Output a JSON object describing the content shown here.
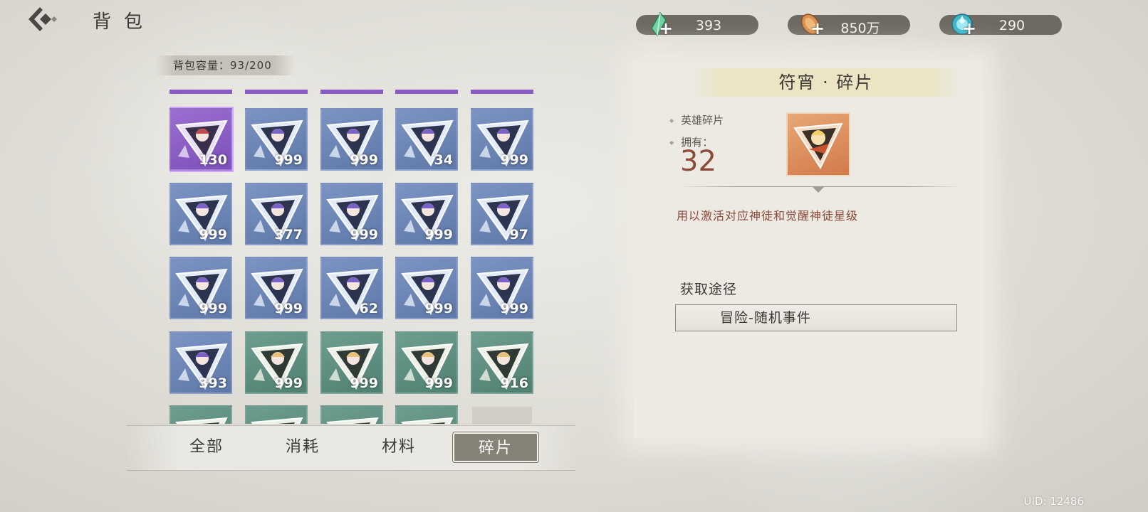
{
  "header": {
    "title": "背包"
  },
  "currencies": [
    {
      "icon": "green-crystal-icon",
      "value": "393"
    },
    {
      "icon": "coin-icon",
      "value": "850万"
    },
    {
      "icon": "blue-gem-icon",
      "value": "290"
    }
  ],
  "capacity": {
    "text": "背包容量：93/200"
  },
  "grid": {
    "items": [
      {
        "rarity": "purple",
        "count": "130",
        "selected": true
      },
      {
        "rarity": "blue",
        "count": "999"
      },
      {
        "rarity": "blue",
        "count": "999"
      },
      {
        "rarity": "blue",
        "count": "34"
      },
      {
        "rarity": "blue",
        "count": "999"
      },
      {
        "rarity": "blue",
        "count": "999"
      },
      {
        "rarity": "blue",
        "count": "377"
      },
      {
        "rarity": "blue",
        "count": "999"
      },
      {
        "rarity": "blue",
        "count": "999"
      },
      {
        "rarity": "blue",
        "count": "97"
      },
      {
        "rarity": "blue",
        "count": "999"
      },
      {
        "rarity": "blue",
        "count": "999"
      },
      {
        "rarity": "blue",
        "count": "62"
      },
      {
        "rarity": "blue",
        "count": "999"
      },
      {
        "rarity": "blue",
        "count": "999"
      },
      {
        "rarity": "blue",
        "count": "393"
      },
      {
        "rarity": "green",
        "count": "999"
      },
      {
        "rarity": "green",
        "count": "999"
      },
      {
        "rarity": "green",
        "count": "999"
      },
      {
        "rarity": "green",
        "count": "916"
      },
      {
        "rarity": "green",
        "count": ""
      },
      {
        "rarity": "green",
        "count": ""
      },
      {
        "rarity": "green",
        "count": ""
      },
      {
        "rarity": "green",
        "count": ""
      },
      {
        "rarity": "empty",
        "count": ""
      }
    ]
  },
  "tabs": [
    {
      "label": "全部",
      "active": false
    },
    {
      "label": "消耗",
      "active": false
    },
    {
      "label": "材料",
      "active": false
    },
    {
      "label": "碎片",
      "active": true
    }
  ],
  "detail": {
    "title": "符宵 · 碎片",
    "type_label": "英雄碎片",
    "owned_label": "拥有：",
    "owned_count": "32",
    "description": "用以激活对应神徒和觉醒神徒星级",
    "source_heading": "获取途径",
    "source_button": "冒险-随机事件"
  },
  "uid": "UID: 12486",
  "colors": {
    "purple": "#8a5bc4",
    "blue": "#6a84b6",
    "green": "#5d8e80",
    "accent_red": "#8b4a3a",
    "tab_active": "#878276"
  }
}
